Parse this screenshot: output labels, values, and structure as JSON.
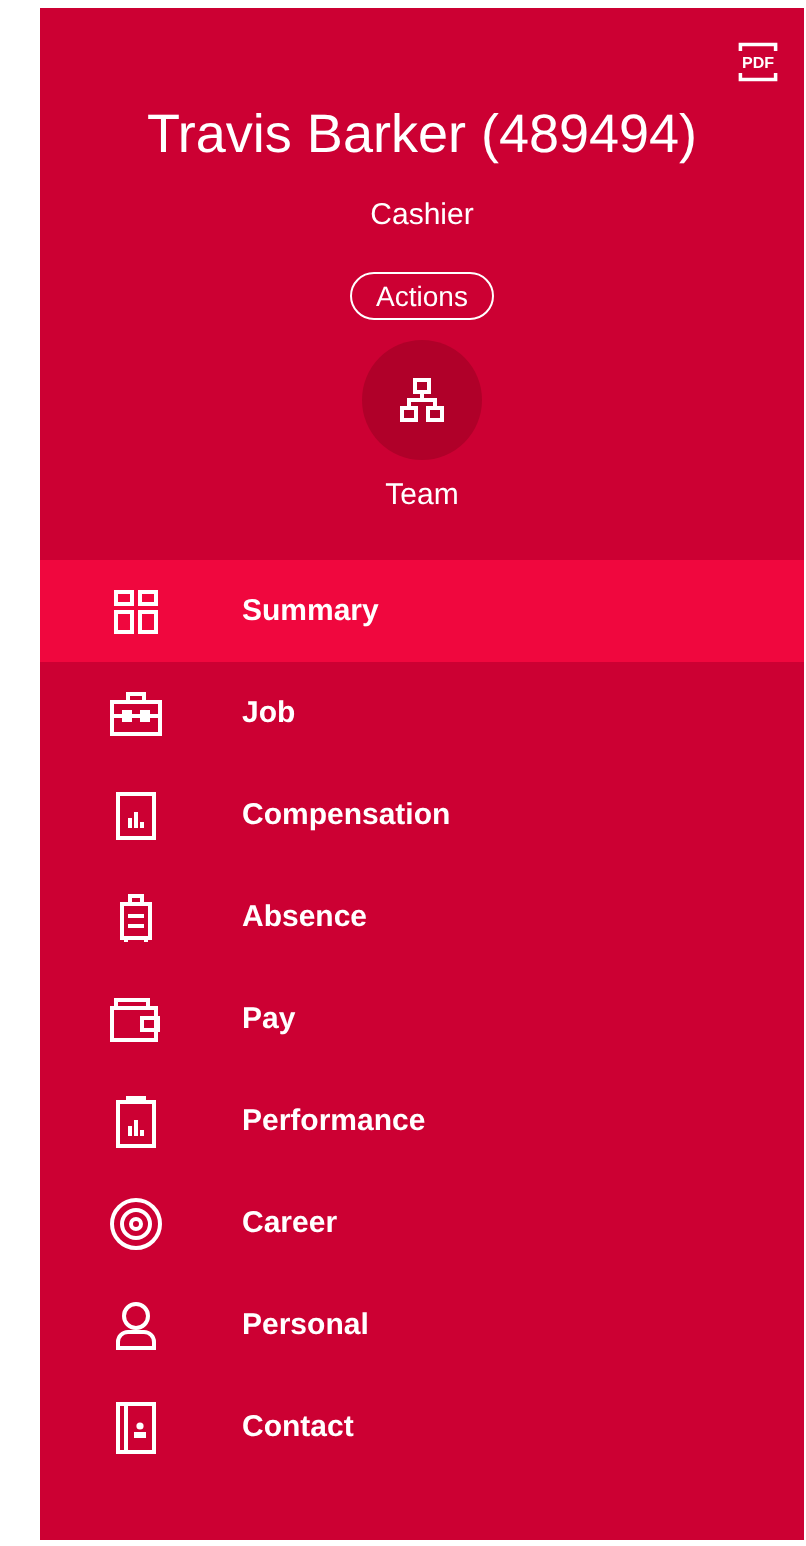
{
  "header": {
    "export_label": "PDF",
    "name": "Travis Barker (489494)",
    "job_title": "Cashier",
    "actions_button": "Actions",
    "team_link": "Team"
  },
  "menu": [
    {
      "kind": "summary",
      "label": "Summary",
      "selected": true
    },
    {
      "kind": "job",
      "label": "Job",
      "selected": false
    },
    {
      "kind": "compensation",
      "label": "Compensation",
      "selected": false
    },
    {
      "kind": "absence",
      "label": "Absence",
      "selected": false
    },
    {
      "kind": "pay",
      "label": "Pay",
      "selected": false
    },
    {
      "kind": "performance",
      "label": "Performance",
      "selected": false
    },
    {
      "kind": "career",
      "label": "Career",
      "selected": false
    },
    {
      "kind": "personal",
      "label": "Personal",
      "selected": false
    },
    {
      "kind": "contact",
      "label": "Contact",
      "selected": false
    }
  ]
}
